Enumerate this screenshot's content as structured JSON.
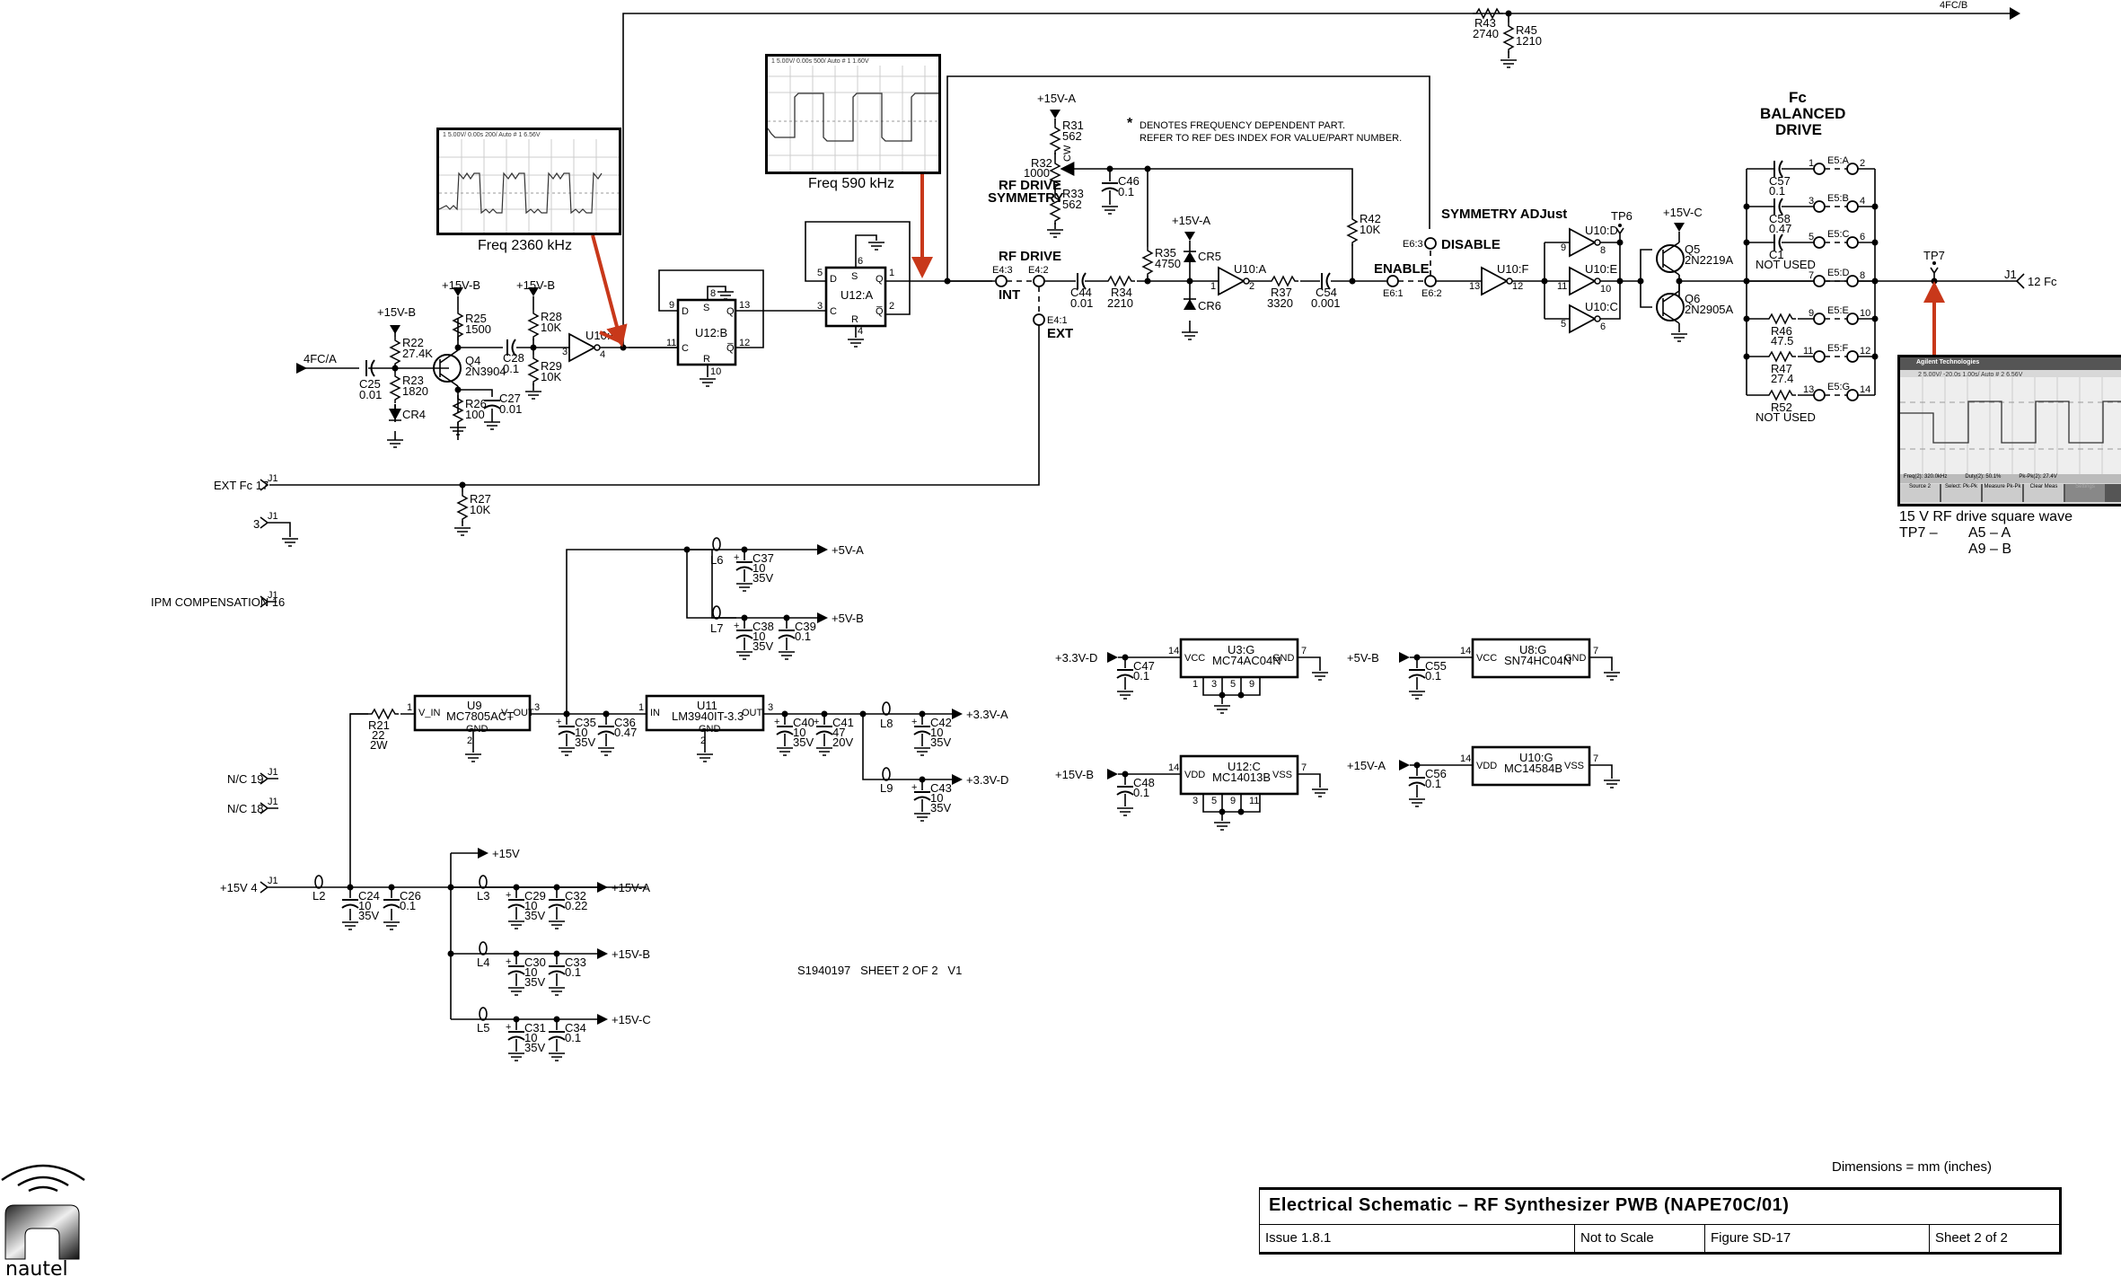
{
  "title_block": {
    "dimensions_note": "Dimensions = mm (inches)",
    "title": "Electrical Schematic – RF Synthesizer PWB (NAPE70C/01)",
    "issue": "Issue 1.8.1",
    "scale": "Not to Scale",
    "figure": "Figure SD-17",
    "sheet": "Sheet 2 of 2"
  },
  "logo": {
    "name": "nautel",
    "icon": "nautel-logo"
  },
  "drawing_number": "S1940197   SHEET 2 OF 2   V1",
  "note": {
    "star": "*",
    "line1": "DENOTES FREQUENCY DEPENDENT PART.",
    "line2": "REFER TO REF DES INDEX FOR VALUE/PART NUMBER."
  },
  "scopes": [
    {
      "caption": "Freq 2360 kHz",
      "header": "1 5.00V/          0.00s  200/  Auto  # 1  6.56V"
    },
    {
      "caption": "Freq 590 kHz",
      "header": "1 5.00V/          0.00s  500/  Auto  # 1  1.60V"
    },
    {
      "caption": "15 V RF drive square wave",
      "caption2": "TP7 –",
      "caption3": "A5 – A",
      "caption4": "A9 – B",
      "brand": "Agilent Technologies",
      "header": "2 5.00V/      -20.0s  1.00s/  Auto  # 2  6.56V",
      "meas": [
        "Freq(2): 320.0kHz",
        "Duty(2): 50.1%",
        "Pk-Pk(2): 27.4V"
      ],
      "softkeys": [
        "Source 2",
        "Select: Pk-Pk",
        "Measure Pk-Pk",
        "Clear Meas",
        "Settings"
      ]
    }
  ],
  "nets": {
    "fc_a": "4FC/A",
    "fc_b": "4FC/B",
    "p15vb": "+15V-B",
    "p15va": "+15V-A",
    "p15vc": "+15V-C",
    "p15v": "+15V",
    "p5va": "+5V-A",
    "p5vb": "+5V-B",
    "p33va": "+3.3V-A",
    "p33vd": "+3.3V-D"
  },
  "labels": {
    "rf_drive_symmetry_1": "RF DRIVE",
    "rf_drive_symmetry_2": "SYMMETRY",
    "rf_drive": "RF DRIVE",
    "int": "INT",
    "ext": "EXT",
    "enable": "ENABLE",
    "disable": "DISABLE",
    "symmetry_adjust": "SYMMETRY ADJust",
    "fc_bal_1": "Fc",
    "fc_bal_2": "BALANCED",
    "fc_bal_3": "DRIVE",
    "cw": "CW",
    "tp6": "TP6",
    "tp7": "TP7"
  },
  "connectors": {
    "ext_fc": "EXT Fc 17",
    "gnd3": "3",
    "ipm": "IPM COMPENSATION 16",
    "nc19": "N/C 19",
    "nc18": "N/C 18",
    "p15v4": "+15V   4",
    "fc12": "12   Fc",
    "j1": "J1"
  },
  "jumpers": {
    "e4_3": "E4:3",
    "e4_2": "E4:2",
    "e4_1": "E4:1",
    "e6_1": "E6:1",
    "e6_2": "E6:2",
    "e6_3": "E6:3",
    "e5": [
      "E5:A",
      "E5:B",
      "E5:C",
      "E5:D",
      "E5:E",
      "E5:F",
      "E5:G"
    ],
    "e5_pins": [
      [
        "1",
        "2"
      ],
      [
        "3",
        "4"
      ],
      [
        "5",
        "6"
      ],
      [
        "7",
        "8"
      ],
      [
        "9",
        "10"
      ],
      [
        "11",
        "12"
      ],
      [
        "13",
        "14"
      ]
    ]
  },
  "components": {
    "r22": [
      "R22",
      "27.4K"
    ],
    "r23": [
      "R23",
      "1820"
    ],
    "c25": [
      "C25",
      "0.01"
    ],
    "cr4": "CR4",
    "r25": [
      "R25",
      "1500"
    ],
    "q4": [
      "Q4",
      "2N3904"
    ],
    "r26": [
      "R26",
      "100"
    ],
    "c27": [
      "C27",
      "0.01"
    ],
    "c28": [
      "C28",
      "0.1"
    ],
    "r28": [
      "R28",
      "10K"
    ],
    "r29": [
      "R29",
      "10K"
    ],
    "u10b": "U10:B",
    "u12b": "U12:B",
    "u12a": "U12:A",
    "r31": [
      "R31",
      "562"
    ],
    "r32": [
      "R32",
      "1000"
    ],
    "r33": [
      "R33",
      "562"
    ],
    "c46": [
      "C46",
      "0.1"
    ],
    "c44": [
      "C44",
      "0.01"
    ],
    "r34": [
      "R34",
      "2210"
    ],
    "r35": [
      "R35",
      "4750"
    ],
    "cr5": "CR5",
    "cr6": "CR6",
    "u10a": "U10:A",
    "r37": [
      "R37",
      "3320"
    ],
    "c54": [
      "C54",
      "0.001"
    ],
    "r42": [
      "R42",
      "10K"
    ],
    "u10f": "U10:F",
    "u10d": "U10:D",
    "u10e": "U10:E",
    "u10c": "U10:C",
    "q5": [
      "Q5",
      "2N2219A"
    ],
    "q6": [
      "Q6",
      "2N2905A"
    ],
    "c57": [
      "C57",
      "0.1"
    ],
    "c58": [
      "C58",
      "0.47"
    ],
    "c1": [
      "C1",
      "NOT USED"
    ],
    "r46": [
      "R46",
      "47.5"
    ],
    "r47": [
      "R47",
      "27.4"
    ],
    "r52": [
      "R52",
      "NOT USED"
    ],
    "r43": [
      "R43",
      "2740"
    ],
    "r45": [
      "R45",
      "1210"
    ],
    "r27": [
      "R27",
      "10K"
    ],
    "r21": [
      "R21",
      "22",
      "2W"
    ],
    "u9": [
      "U9",
      "MC7805ACT",
      "V_IN",
      "V_OUT",
      "GND"
    ],
    "c35": [
      "C35",
      "10",
      "35V"
    ],
    "c36": [
      "C36",
      "0.47"
    ],
    "u11": [
      "U11",
      "LM3940IT-3.3",
      "IN",
      "OUT",
      "GND"
    ],
    "c40": [
      "C40",
      "10",
      "35V"
    ],
    "c41": [
      "C41",
      "47",
      "20V"
    ],
    "c42": [
      "C42",
      "10",
      "35V"
    ],
    "c43": [
      "C43",
      "10",
      "35V"
    ],
    "c37": [
      "C37",
      "10",
      "35V"
    ],
    "c38": [
      "C38",
      "10",
      "35V"
    ],
    "c39": [
      "C39",
      "0.1"
    ],
    "l": [
      "L2",
      "L3",
      "L4",
      "L5",
      "L6",
      "L7",
      "L8",
      "L9"
    ],
    "c24": [
      "C24",
      "10",
      "35V"
    ],
    "c26": [
      "C26",
      "0.1"
    ],
    "c29": [
      "C29",
      "10",
      "35V"
    ],
    "c32": [
      "C32",
      "0.22"
    ],
    "c30": [
      "C30",
      "10",
      "35V"
    ],
    "c33": [
      "C33",
      "0.1"
    ],
    "c31": [
      "C31",
      "10",
      "35V"
    ],
    "c34": [
      "C34",
      "0.1"
    ],
    "u3g": [
      "U3:G",
      "MC74AC04N",
      "VCC",
      "GND"
    ],
    "c47": [
      "C47",
      "0.1"
    ],
    "u12c": [
      "U12:C",
      "MC14013B",
      "VDD",
      "VSS"
    ],
    "c48": [
      "C48",
      "0.1"
    ],
    "u8g": [
      "U8:G",
      "SN74HC04N",
      "VCC",
      "GND"
    ],
    "c55": [
      "C55",
      "0.1"
    ],
    "u10g": [
      "U10:G",
      "MC14584B",
      "VDD",
      "VSS"
    ],
    "c56": [
      "C56",
      "0.1"
    ]
  },
  "pins": {
    "u10b": [
      "3",
      "4"
    ],
    "u10a": [
      "1",
      "2"
    ],
    "u10f": [
      "13",
      "12"
    ],
    "u10d": [
      "9",
      "8"
    ],
    "u10e": [
      "11",
      "10"
    ],
    "u10c": [
      "5",
      "6"
    ],
    "u12b": [
      "9",
      "11",
      "8",
      "13",
      "12",
      "10",
      "D",
      "C",
      "S",
      "R",
      "Q",
      "Q̅"
    ],
    "u12a": [
      "5",
      "3",
      "6",
      "1",
      "2",
      "4",
      "D",
      "C",
      "S",
      "R",
      "Q",
      "Q̅"
    ],
    "reg": [
      "1",
      "3",
      "2"
    ],
    "u3g": [
      "14",
      "7",
      "1",
      "3",
      "5",
      "9"
    ],
    "u12c": [
      "14",
      "7",
      "3",
      "5",
      "9",
      "11"
    ],
    "u8g": [
      "14",
      "7"
    ],
    "u10g": [
      "14",
      "7"
    ]
  },
  "colors": {
    "annotation_arrow": "#c8381a",
    "ink": "#000000"
  }
}
